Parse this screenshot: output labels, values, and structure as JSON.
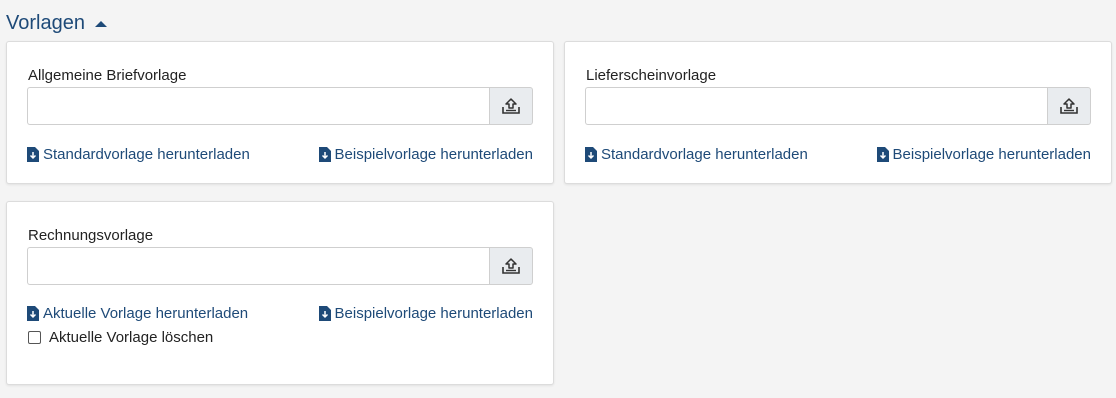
{
  "section": {
    "title": "Vorlagen"
  },
  "cards": {
    "brief": {
      "label": "Allgemeine Briefvorlage",
      "link_left": "Standardvorlage herunterladen",
      "link_right": "Beispielvorlage herunterladen"
    },
    "lieferschein": {
      "label": "Lieferscheinvorlage",
      "link_left": "Standardvorlage herunterladen",
      "link_right": "Beispielvorlage herunterladen"
    },
    "rechnung": {
      "label": "Rechnungsvorlage",
      "link_left": "Aktuelle Vorlage herunterladen",
      "link_right": "Beispielvorlage herunterladen",
      "checkbox_label": "Aktuelle Vorlage löschen"
    }
  },
  "icons": {
    "upload": "upload-icon",
    "download": "file-download-icon",
    "toggle": "caret-up-icon"
  },
  "colors": {
    "link": "#1e4a78",
    "background": "#f4f4f4",
    "card": "#ffffff",
    "button": "#e9ecef"
  }
}
